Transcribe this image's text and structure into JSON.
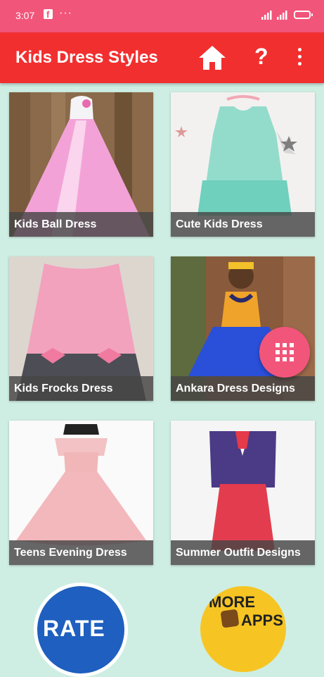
{
  "status_bar": {
    "time": "3:07",
    "fb_letter": "f",
    "more_dots": "···"
  },
  "app_bar": {
    "title": "Kids Dress Styles",
    "help_symbol": "?",
    "icons": [
      "home-icon",
      "help-icon",
      "overflow-menu-icon"
    ]
  },
  "cards": [
    {
      "label": "Kids Ball Dress"
    },
    {
      "label": "Cute Kids  Dress"
    },
    {
      "label": "Kids Frocks Dress"
    },
    {
      "label": "Ankara Dress Designs"
    },
    {
      "label": "Teens Evening Dress"
    },
    {
      "label": "Summer Outfit Designs"
    }
  ],
  "bottom": {
    "rate_text": "RATE",
    "more_apps_line1": "MORE",
    "more_apps_line2": "APPS"
  },
  "colors": {
    "status_bar": "#f2557a",
    "app_bar": "#f22f2f",
    "background": "#cfeee3",
    "fab": "#f2557a"
  }
}
